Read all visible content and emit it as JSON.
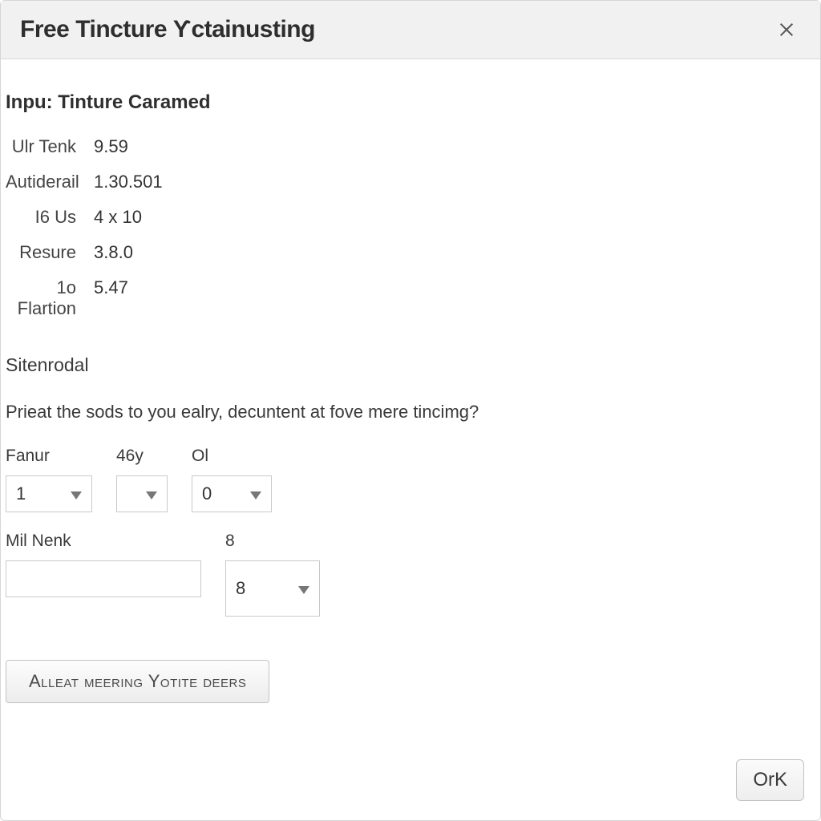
{
  "dialog": {
    "title": "Free Tincture Ƴctainusting"
  },
  "section": {
    "input_heading": "Inpu: Tinture Caramed"
  },
  "info": [
    {
      "label": "Ulr Tenk",
      "value": "9.59"
    },
    {
      "label": "Autiderail",
      "value": "1.30.501"
    },
    {
      "label": "I6 Us",
      "value": "4 x 10"
    },
    {
      "label": "Resure",
      "value": "3.8.0"
    },
    {
      "label": "1o Flartion",
      "value": "5.47"
    }
  ],
  "sub_heading": "Sitenrodal",
  "prompt": "Prieat the sods to you ealry, decuntent at fove mere tincimg?",
  "fields": {
    "fanur": {
      "label": "Fanur",
      "value": "1"
    },
    "f46y": {
      "label": "46y",
      "value": ""
    },
    "ol": {
      "label": "Ol",
      "value": "0"
    },
    "mil_nenk": {
      "label": "Mil Nenk",
      "value": ""
    },
    "eight": {
      "label": "8",
      "value": "8"
    }
  },
  "buttons": {
    "action": "Alleat meering Yotite deers",
    "ok": "OrK"
  }
}
